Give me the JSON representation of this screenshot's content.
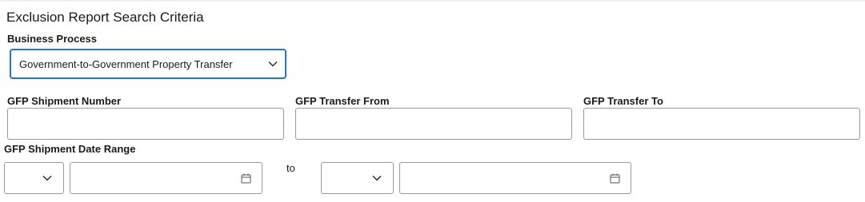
{
  "page": {
    "title": "Exclusion Report Search Criteria"
  },
  "business_process": {
    "label": "Business Process",
    "selected": "Government-to-Government Property Transfer"
  },
  "fields": {
    "shipment_number_label": "GFP Shipment Number",
    "transfer_from_label": "GFP Transfer From",
    "transfer_to_label": "GFP Transfer To",
    "shipment_number_value": "",
    "transfer_from_value": "",
    "transfer_to_value": ""
  },
  "date_range": {
    "label": "GFP Shipment Date Range",
    "separator": "to",
    "start_operator": "",
    "start_date": "",
    "end_operator": "",
    "end_date": ""
  },
  "icons": {
    "dropdown": "chevron-down-icon",
    "calendar": "calendar-icon"
  },
  "colors": {
    "focus_border": "#2378c3",
    "input_border": "#9a9a9a"
  }
}
